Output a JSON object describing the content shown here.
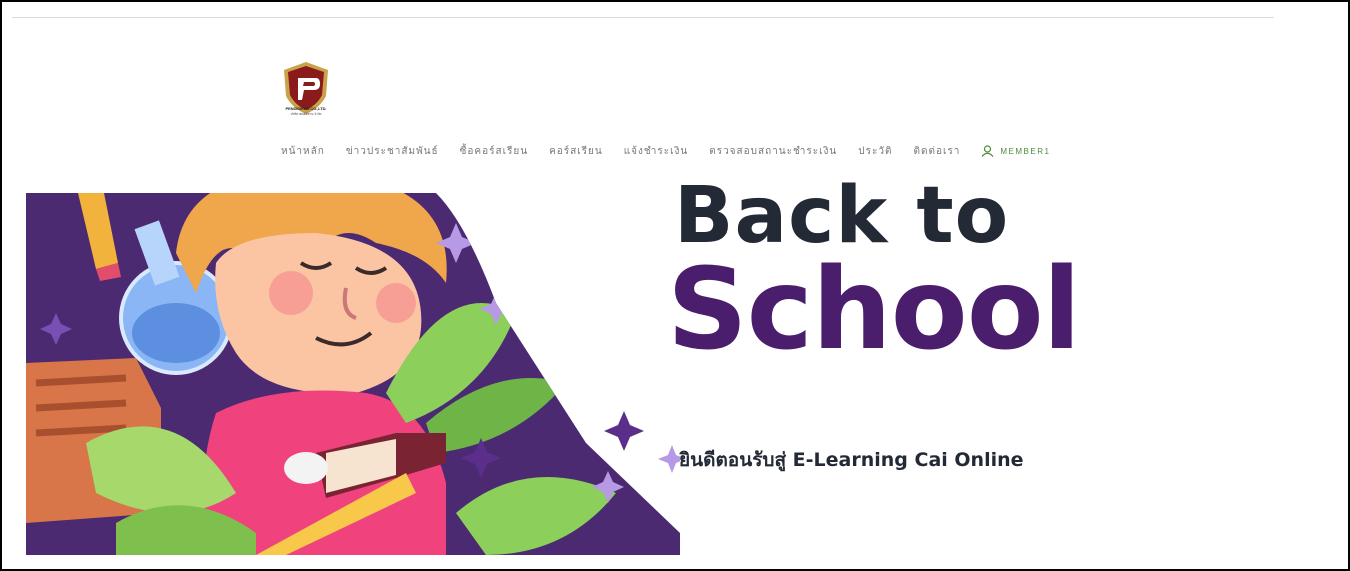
{
  "brand": {
    "name": "PENDIDIKAN CO.,LTD.",
    "tagline": "บริษัท เพนดิดิคาน จำกัด",
    "colors": {
      "shield": "#8b1a1a",
      "shield_border": "#c9a24b",
      "letter": "#ffffff"
    }
  },
  "nav": {
    "items": [
      {
        "label": "หน้าหลัก"
      },
      {
        "label": "ข่าวประชาสัมพันธ์"
      },
      {
        "label": "ซื้อคอร์สเรียน"
      },
      {
        "label": "คอร์สเรียน"
      },
      {
        "label": "แจ้งชำระเงิน"
      },
      {
        "label": "ตรวจสอบสถานะชำระเงิน"
      },
      {
        "label": "ประวัติ"
      },
      {
        "label": "ติดต่อเรา"
      }
    ],
    "member": {
      "label": "MEMBER1",
      "icon": "user-icon"
    }
  },
  "hero": {
    "headline_top": "Back to",
    "headline_main": "School",
    "welcome": "ยินดีตอนรับสู่ E-Learning Cai Online",
    "colors": {
      "headline_top": "#232a35",
      "headline_main": "#4a1e6d",
      "art_bg": "#4b2a72",
      "shirt": "#f0437e",
      "hair": "#f0a64a",
      "leaf": "#7fbf4d",
      "star": "#5a2e8a"
    }
  }
}
